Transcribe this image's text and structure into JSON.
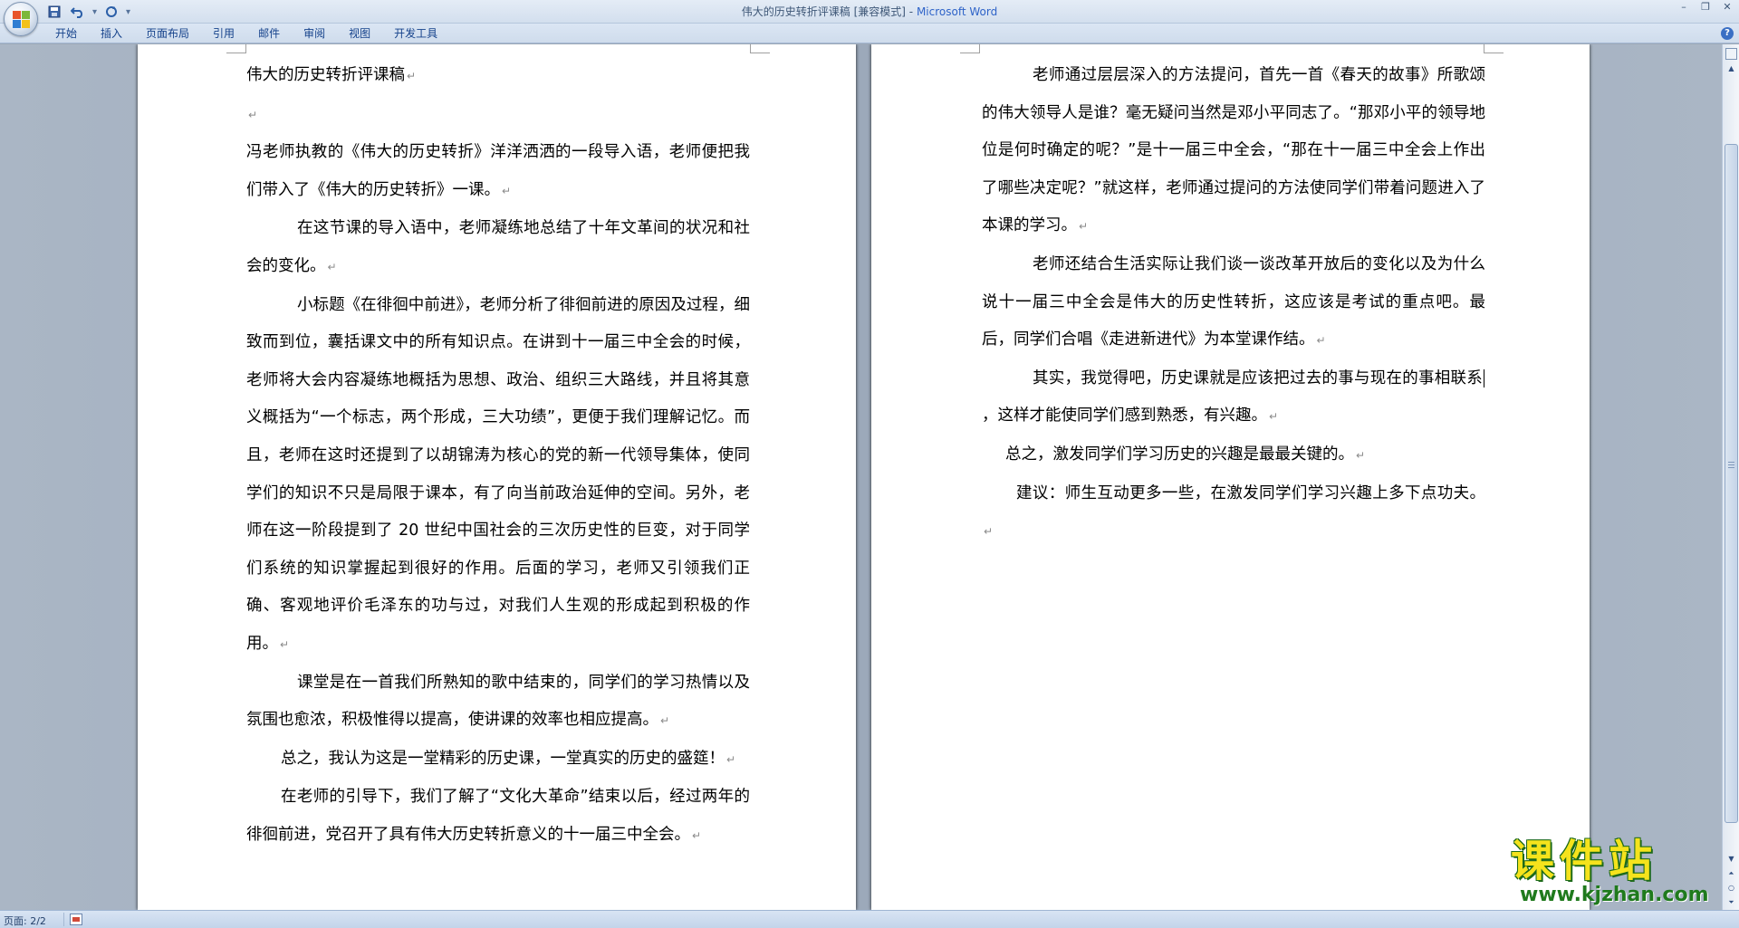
{
  "window": {
    "doc_title": "伟大的历史转折评课稿 [兼容模式]",
    "title_sep": " - ",
    "app_name": "Microsoft Word",
    "minimize": "–",
    "restore": "❐",
    "close": "✕"
  },
  "qat": {
    "customize": "▾"
  },
  "ribbon": {
    "tabs": [
      "开始",
      "插入",
      "页面布局",
      "引用",
      "邮件",
      "审阅",
      "视图",
      "开发工具"
    ],
    "help": "?"
  },
  "document": {
    "left_page": [
      {
        "text": "伟大的历史转折评课稿",
        "indent": "none"
      },
      {
        "text": "",
        "indent": "none"
      },
      {
        "text": "冯老师执教的《伟大的历史转折》洋洋洒洒的一段导入语，老师便把我们带入了《伟大的历史转折》一课。",
        "indent": "none"
      },
      {
        "text": "在这节课的导入语中，老师凝练地总结了十年文革间的状况和社会的变化。",
        "indent": "indent"
      },
      {
        "text": "小标题《在徘徊中前进》，老师分析了徘徊前进的原因及过程，细致而到位，囊括课文中的所有知识点。在讲到十一届三中全会的时候，老师将大会内容凝练地概括为思想、政治、组织三大路线，并且将其意义概括为“一个标志，两个形成，三大功绩”，更便于我们理解记忆。而且，老师在这时还提到了以胡锦涛为核心的党的新一代领导集体，使同学们的知识不只是局限于课本，有了向当前政治延伸的空间。另外，老师在这一阶段提到了 20 世纪中国社会的三次历史性的巨变，对于同学们系统的知识掌握起到很好的作用。后面的学习，老师又引领我们正确、客观地评价毛泽东的功与过，对我们人生观的形成起到积极的作用。",
        "indent": "indent"
      },
      {
        "text": "课堂是在一首我们所熟知的歌中结束的，同学们的学习热情以及氛围也愈浓，积极惟得以提高，使讲课的效率也相应提高。",
        "indent": "indent"
      },
      {
        "text": "总之，我认为这是一堂精彩的历史课，一堂真实的历史的盛筵！",
        "indent": "indent-mid"
      },
      {
        "text": "在老师的引导下，我们了解了“文化大革命”结束以后，经过两年的徘徊前进，党召开了具有伟大历史转折意义的十一届三中全会。",
        "indent": "indent-mid"
      }
    ],
    "right_page": [
      {
        "text": "老师通过层层深入的方法提问，首先一首《春天的故事》所歌颂的伟大领导人是谁？毫无疑问当然是邓小平同志了。“那邓小平的领导地位是何时确定的呢？”是十一届三中全会，“那在十一届三中全会上作出了哪些决定呢？”就这样，老师通过提问的方法使同学们带着问题进入了本课的学习。",
        "indent": "indent"
      },
      {
        "text": "老师还结合生活实际让我们谈一谈改革开放后的变化以及为什么说十一届三中全会是伟大的历史性转折，这应该是考试的重点吧。最后，同学们合唱《走进新进代》为本堂课作结。",
        "indent": "indent"
      },
      {
        "text_before_cursor": "其实，我觉得吧，历史课就是应该把过去的事与现在的事相联系",
        "text_after_cursor": "，这样才能使同学们感到熟悉，有兴趣。",
        "indent": "indent",
        "has_cursor": true
      },
      {
        "text": "总之，激发同学们学习历史的兴趣是最最关键的。",
        "indent": "indent-tiny"
      },
      {
        "text": "建议：师生互动更多一些，在激发同学们学习兴趣上多下点功夫。",
        "indent": "indent-mid"
      }
    ],
    "paragraph_mark": "↵"
  },
  "statusbar": {
    "page_info": "页面: 2/2"
  },
  "watermark": {
    "title": "课件站",
    "url": "www.kjzhan.com"
  },
  "colors": {
    "app_name": "#2e63c8",
    "tab_text": "#15428b",
    "watermark_yellow": "#f5e31c",
    "watermark_green": "#1f7a1d"
  }
}
